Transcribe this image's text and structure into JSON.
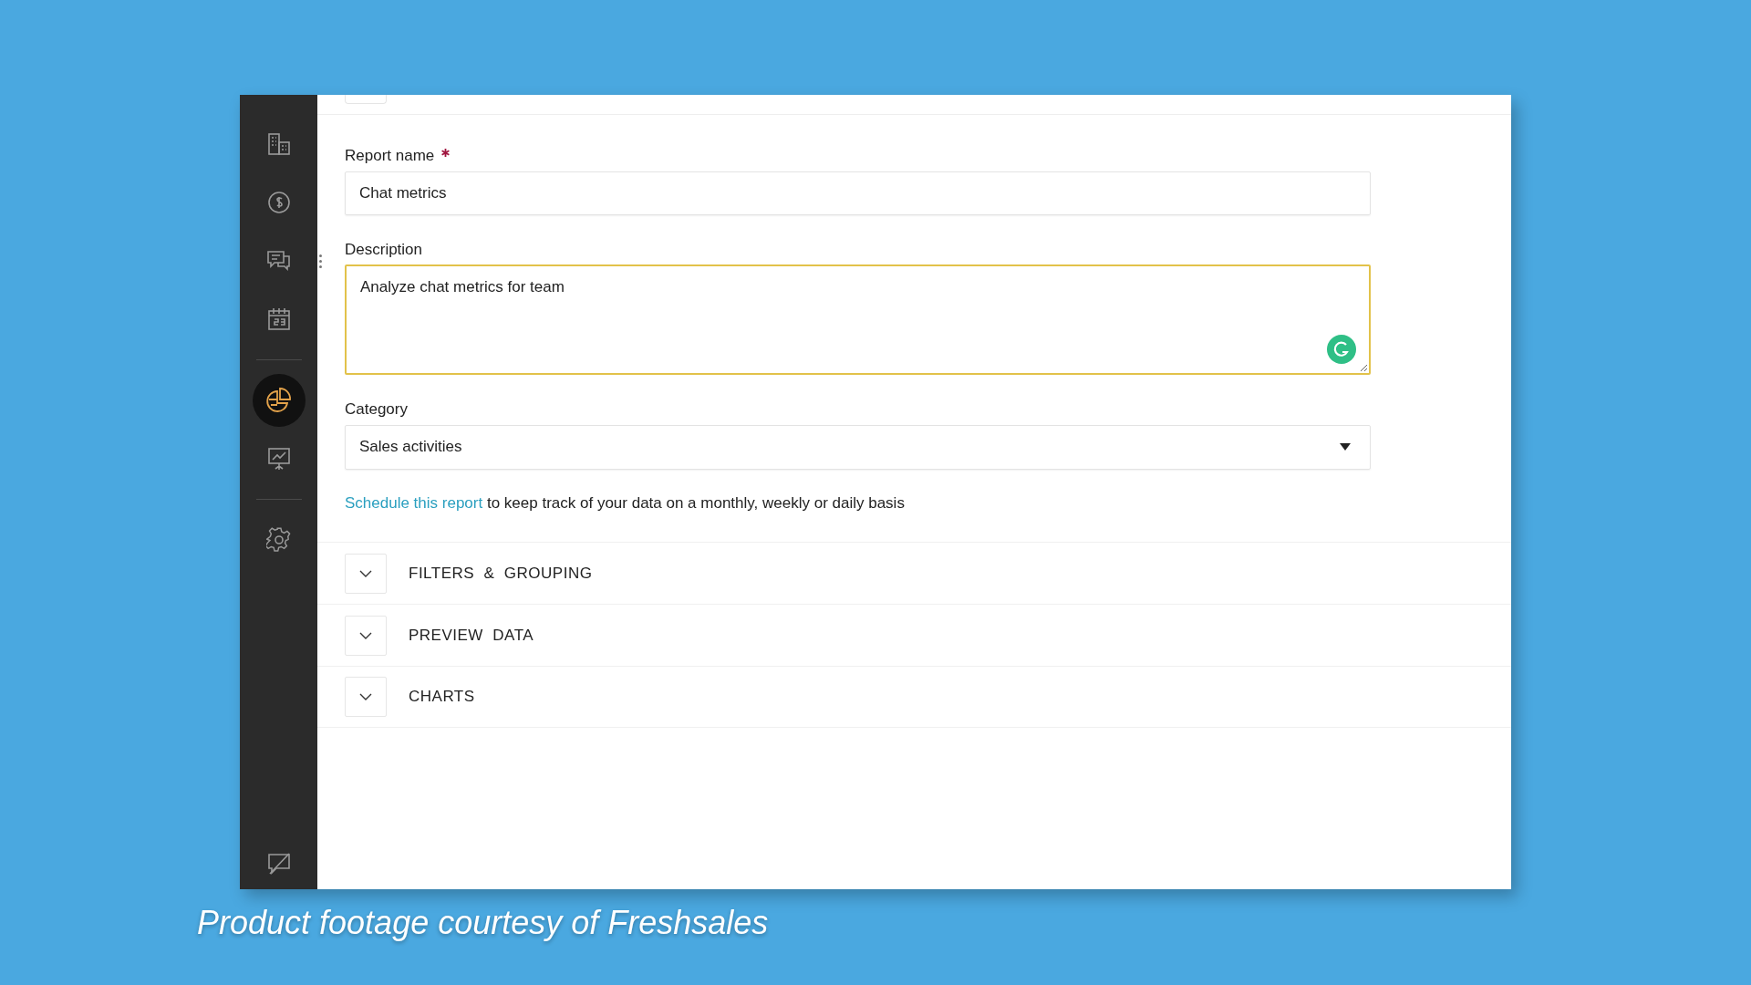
{
  "sidebar": {
    "items": [
      {
        "kind": "building",
        "selected": false
      },
      {
        "kind": "dollar",
        "selected": false
      },
      {
        "kind": "chat",
        "selected": false
      },
      {
        "kind": "calendar",
        "selected": false
      },
      {
        "kind": "divider"
      },
      {
        "kind": "pie",
        "selected": true
      },
      {
        "kind": "presentation",
        "selected": false
      },
      {
        "kind": "divider"
      },
      {
        "kind": "gear",
        "selected": false
      }
    ],
    "bottom": {
      "kind": "comment-off"
    }
  },
  "form": {
    "fields": [
      {
        "kind": "input",
        "label": "Report name",
        "required": true,
        "value": "Chat metrics",
        "focused": false
      },
      {
        "kind": "textarea",
        "label": "Description",
        "required": false,
        "value": "Analyze chat metrics for team",
        "focused": true
      },
      {
        "kind": "select",
        "label": "Category",
        "required": false,
        "value": "Sales activities",
        "focused": false
      }
    ],
    "schedule": {
      "link": "Schedule this report",
      "text": "to keep track of your data on a monthly, weekly or daily basis"
    },
    "sections": [
      {
        "title": "FILTERS  &  GROUPING",
        "expanded": false
      },
      {
        "title": "PREVIEW  DATA",
        "expanded": false
      },
      {
        "title": "CHARTS",
        "expanded": false
      }
    ]
  },
  "caption": "Product footage courtesy of Freshsales"
}
